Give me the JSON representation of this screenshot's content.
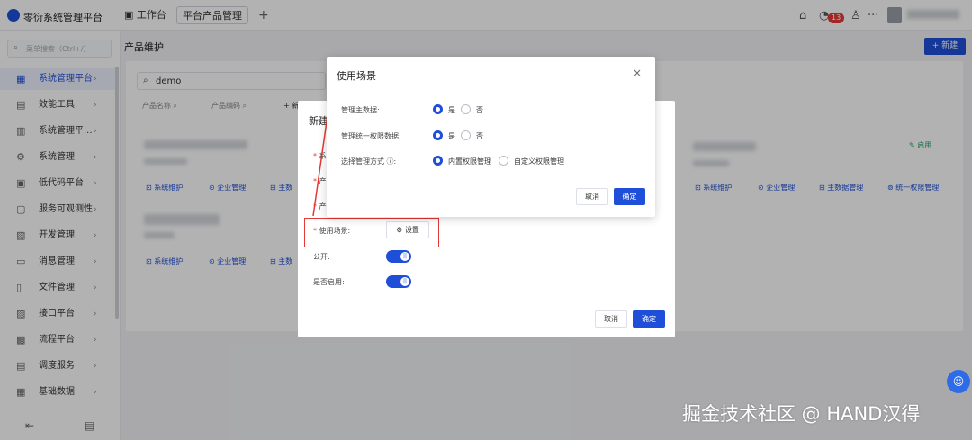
{
  "app": {
    "title": "零衍系统管理平台"
  },
  "tabs": {
    "work": "工作台",
    "active": "平台产品管理",
    "plus": "+"
  },
  "topbar": {
    "badge": "13",
    "more": "···"
  },
  "sidebar": {
    "search_placeholder": "菜单搜索（Ctrl+/）",
    "items": [
      {
        "label": "系统管理平台",
        "icon": "building-icon",
        "active": true
      },
      {
        "label": "效能工具",
        "icon": "tool-icon"
      },
      {
        "label": "系统管理平...",
        "icon": "system-icon"
      },
      {
        "label": "系统管理",
        "icon": "gear-icon"
      },
      {
        "label": "低代码平台",
        "icon": "code-icon"
      },
      {
        "label": "服务可观测性",
        "icon": "monitor-icon"
      },
      {
        "label": "开发管理",
        "icon": "dev-icon"
      },
      {
        "label": "消息管理",
        "icon": "message-icon"
      },
      {
        "label": "文件管理",
        "icon": "file-icon"
      },
      {
        "label": "接口平台",
        "icon": "api-icon"
      },
      {
        "label": "流程平台",
        "icon": "flow-icon"
      },
      {
        "label": "调度服务",
        "icon": "schedule-icon"
      },
      {
        "label": "基础数据",
        "icon": "data-icon"
      }
    ]
  },
  "page": {
    "title": "产品维护",
    "new_button": "+ 新建"
  },
  "search": {
    "value": "demo"
  },
  "filters": {
    "product_name": "产品名称",
    "product_code": "产品编码",
    "add": "+ 新"
  },
  "card_links": {
    "sys": "系统维护",
    "company": "企业管理",
    "master": "主数",
    "master_full": "主数据管理",
    "perm": "统一权限管理"
  },
  "enabled": "启用",
  "dialog_new": {
    "title": "新建",
    "usage_label": "使用场景:",
    "settings_button": "设置",
    "public_label": "公开:",
    "enable_label": "是否启用:",
    "cancel": "取消",
    "ok": "确定"
  },
  "dialog_usage": {
    "title": "使用场景",
    "close": "×",
    "rows": [
      {
        "label": "管理主数据:",
        "opt1": "是",
        "opt2": "否"
      },
      {
        "label": "管理统一权限数据:",
        "opt1": "是",
        "opt2": "否"
      },
      {
        "label": "选择管理方式 ⓘ:",
        "opt1": "内置权限管理",
        "opt2": "自定义权限管理"
      }
    ],
    "cancel": "取消",
    "ok": "确定"
  },
  "watermark": "掘金技术社区 @ HAND汉得"
}
